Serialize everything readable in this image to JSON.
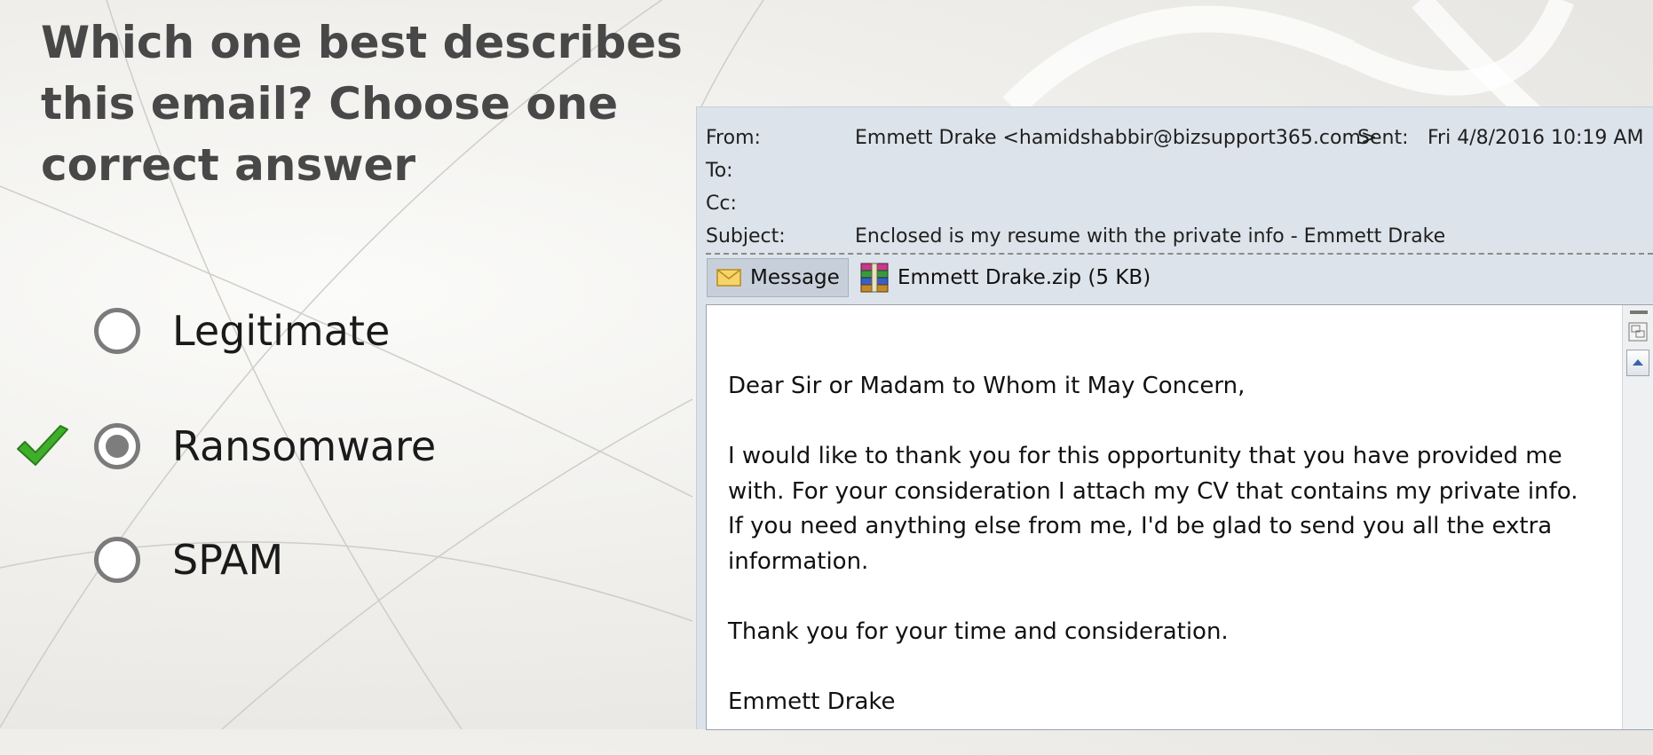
{
  "question": {
    "text": "Which one best describes this email?  Choose one correct answer"
  },
  "options": [
    {
      "label": "Legitimate",
      "selected": false
    },
    {
      "label": "Ransomware",
      "selected": true
    },
    {
      "label": "SPAM",
      "selected": false
    }
  ],
  "email": {
    "from_label": "From:",
    "from_value": "Emmett Drake <hamidshabbir@bizsupport365.com>",
    "sent_label": "Sent:",
    "sent_value": "Fri 4/8/2016 10:19 AM",
    "to_label": "To:",
    "cc_label": "Cc:",
    "subject_label": "Subject:",
    "subject_value": "Enclosed is my resume with the private info - Emmett Drake",
    "message_tab": "Message",
    "attachment": "Emmett Drake.zip (5 KB)",
    "body": {
      "greeting": "Dear Sir or Madam to Whom it May Concern,",
      "paragraph": "I would like to thank you for this opportunity that you have provided me with. For your consideration I attach my CV that contains my private info. If you need anything else from me, I'd be glad to send you all the extra information.",
      "thanks": "Thank you for your time and consideration.",
      "signature": "Emmett Drake"
    }
  },
  "icons": {
    "check": "checkmark-icon",
    "message": "envelope-icon",
    "attachment": "archive-file-icon"
  },
  "colors": {
    "check_green": "#3fae2a",
    "radio_border": "#7b7b7b",
    "header_bg": "#dde3ea"
  }
}
